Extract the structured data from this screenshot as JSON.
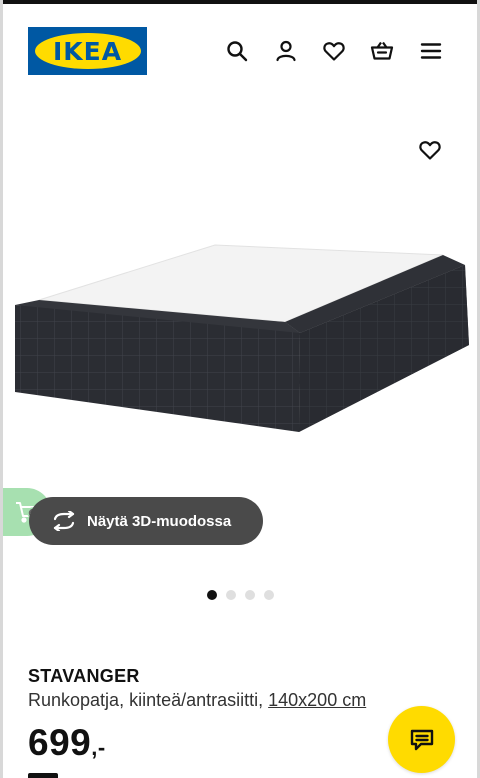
{
  "header": {
    "logo_text": "IKEA",
    "icons": [
      "search-icon",
      "account-icon",
      "heart-icon",
      "cart-icon",
      "menu-icon"
    ]
  },
  "gallery": {
    "favorite_icon": "heart-icon",
    "view_3d_label": "Näytä 3D-muodossa",
    "ar_icon": "ar-cart-icon",
    "slide_count": 4,
    "active_slide": 1
  },
  "product": {
    "name": "STAVANGER",
    "description": "Runkopatja, kiinteä/antrasiitti, ",
    "size": "140x200 cm",
    "price": "699",
    "price_suffix": ",-"
  },
  "chat": {
    "icon": "chat-icon",
    "color": "#ffdb00"
  },
  "colors": {
    "brand_blue": "#0058a3",
    "brand_yellow": "#ffdb00",
    "view3d_bg": "#4a4a4a",
    "ar_badge": "#a7e0b0"
  }
}
